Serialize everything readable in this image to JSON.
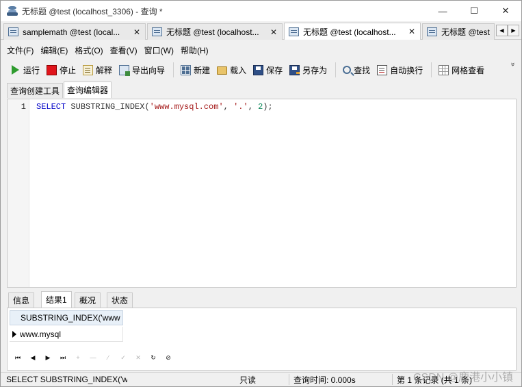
{
  "window": {
    "title": "无标题 @test (localhost_3306) - 查询 *",
    "controls": {
      "minimize": "—",
      "maximize": "☐",
      "close": "✕"
    }
  },
  "doc_tabs": [
    {
      "label": "samplemath @test (local...",
      "close": "✕",
      "active": false
    },
    {
      "label": "无标题 @test (localhost...",
      "close": "✕",
      "active": false
    },
    {
      "label": "无标题 @test (localhost...",
      "close": "✕",
      "active": true
    },
    {
      "label": "无标题 @test",
      "close": "",
      "active": false
    }
  ],
  "tab_scroll": {
    "left": "◀",
    "right": "▶"
  },
  "menu": [
    "文件(F)",
    "编辑(E)",
    "格式(O)",
    "查看(V)",
    "窗口(W)",
    "帮助(H)"
  ],
  "toolbar": {
    "run": "运行",
    "stop": "停止",
    "explain": "解释",
    "export": "导出向导",
    "new": "新建",
    "load": "载入",
    "save": "保存",
    "save_as": "另存为",
    "find": "查找",
    "wrap": "自动换行",
    "grid_view": "网格查看",
    "more": "»"
  },
  "editor_tabs": [
    "查询创建工具",
    "查询编辑器"
  ],
  "editor": {
    "line_number": "1",
    "tokens": {
      "kw": "SELECT",
      "sp1": " ",
      "fn": "SUBSTRING_INDEX(",
      "s1": "'www.mysql.com'",
      "c1": ", ",
      "s2": "'.'",
      "c2": ", ",
      "n": "2",
      "end": ");"
    }
  },
  "result_tabs": [
    "信息",
    "结果1",
    "概况",
    "状态"
  ],
  "results": {
    "column": "SUBSTRING_INDEX('www",
    "value": "www.mysql"
  },
  "nav": {
    "first": "⏮",
    "prev": "◀",
    "next": "▶",
    "last": "⏭",
    "add": "+",
    "delete": "—",
    "edit": "∕",
    "apply": "✓",
    "cancel": "✕",
    "refresh": "↻",
    "stop": "⊘"
  },
  "status": {
    "sql": "SELECT SUBSTRING_INDEX('ww",
    "readonly": "只读",
    "query_time": "查询时间: 0.000s",
    "record": "第 1 条记录 (共 1 条)"
  },
  "watermark": "CSDN @鹿港小小镇"
}
